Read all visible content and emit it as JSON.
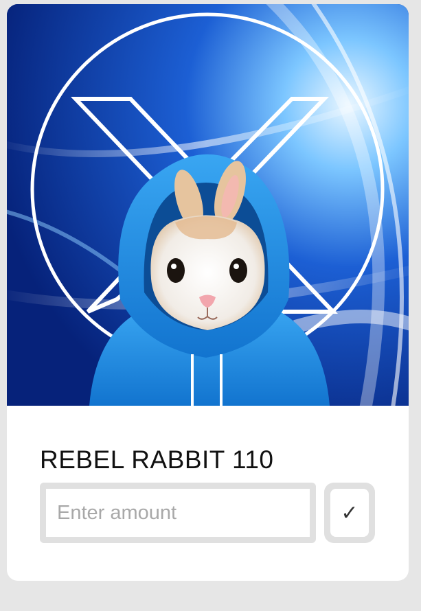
{
  "card": {
    "title": "REBEL RABBIT 110",
    "image_subject": "rabbit-in-blue-hoodie-with-x-logo",
    "amount_input": {
      "value": "",
      "placeholder": "Enter amount"
    },
    "confirm_button": {
      "icon": "check-icon",
      "glyph": "✓"
    }
  },
  "colors": {
    "background": "#e6e6e6",
    "card": "#ffffff",
    "artwork_blue": "#0a2f86",
    "hoodie_blue": "#1e8fe0",
    "field_border": "#e0e0e0",
    "placeholder": "#a8a8a8"
  }
}
